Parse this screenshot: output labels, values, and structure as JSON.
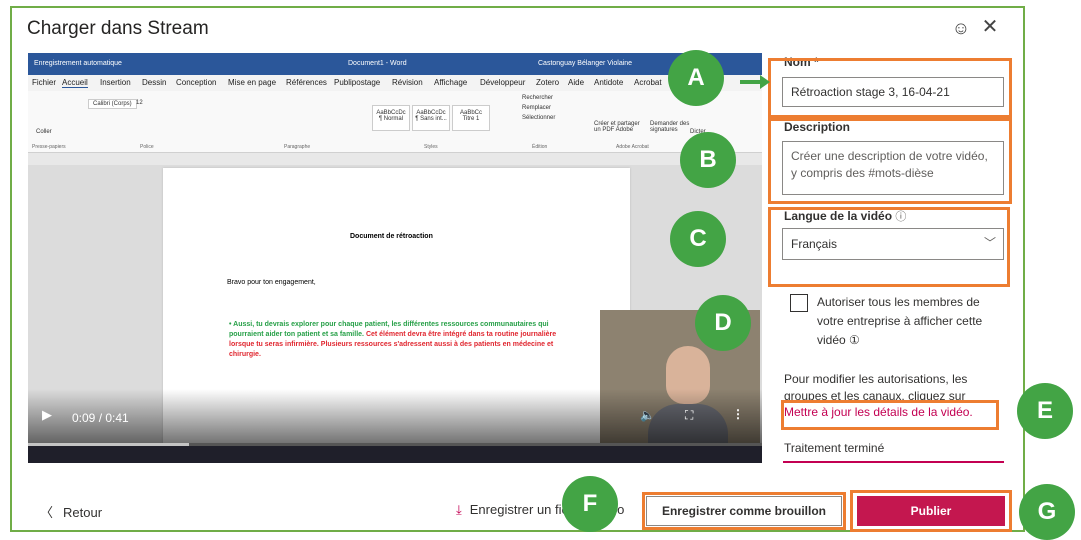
{
  "dialog": {
    "title": "Charger dans Stream",
    "close_icon": "close-icon",
    "feedback_icon": "smiley-icon"
  },
  "word": {
    "autosave": "Enregistrement automatique",
    "doc_name": "Document1 - Word",
    "user": "Castonguay Bélanger Violaine",
    "menus": [
      "Fichier",
      "Accueil",
      "Insertion",
      "Dessin",
      "Conception",
      "Mise en page",
      "Références",
      "Publipostage",
      "Révision",
      "Affichage",
      "Développeur",
      "Zotero",
      "Aide",
      "Antidote",
      "Acrobat"
    ],
    "font_name": "Calibri (Corps)",
    "font_size": "12",
    "paste": "Coller",
    "groups": [
      "Presse-papiers",
      "Police",
      "Paragraphe",
      "Styles",
      "Édition",
      "Adobe Acrobat"
    ],
    "styles": [
      "AaBbCcDc",
      "AaBbCcDc",
      "AaBbCc"
    ],
    "style_names": [
      "¶ Normal",
      "¶ Sans int...",
      "Titre 1"
    ],
    "editing": [
      "Rechercher",
      "Remplacer",
      "Sélectionner"
    ],
    "acrobat": [
      "Créer et partager un PDF Adobe",
      "Demander des signatures"
    ],
    "dictate": "Dicter"
  },
  "document": {
    "title": "Document de rétroaction",
    "p1": "Bravo pour ton engagement,",
    "bullet_green": "Aussi, tu devrais explorer pour chaque patient, les différentes ressources communautaires qui pourraient aider ton patient et sa famille.",
    "bullet_red": "Cet élément devra être intégré dans ta routine journalière lorsque tu seras infirmière. Plusieurs ressources s'adressent aussi à des patients en médecine et chirurgie."
  },
  "player": {
    "time": "0:09 / 0:41",
    "progress": 0.22,
    "play_icon": "play-icon",
    "volume_icon": "volume-icon",
    "fullscreen_icon": "fullscreen-icon",
    "more_icon": "more-icon"
  },
  "form": {
    "name_label": "Nom *",
    "name_value": "Rétroaction stage 3, 16-04-21",
    "desc_label": "Description",
    "desc_placeholder": "Créer une description de votre vidéo, y compris des #mots-dièse",
    "lang_label": "Langue de la vidéo",
    "lang_info_icon": "info-icon",
    "lang_value": "Français",
    "allow_label": "Autoriser tous les membres de votre entreprise à afficher cette vidéo ①",
    "perm_text": "Pour modifier les autorisations, les groupes et les canaux, cliquez sur",
    "perm_link": "Mettre à jour les détails de la vidéo.",
    "status": "Traitement terminé"
  },
  "footer": {
    "back": "Retour",
    "download": "Enregistrer un fichier vidéo",
    "draft": "Enregistrer comme brouillon",
    "publish": "Publier"
  },
  "badges": [
    "A",
    "B",
    "C",
    "D",
    "E",
    "F",
    "G"
  ],
  "colors": {
    "accent": "#c4174f",
    "badge": "#43a445",
    "highlight": "#ed7d31",
    "frame": "#70ad47"
  }
}
